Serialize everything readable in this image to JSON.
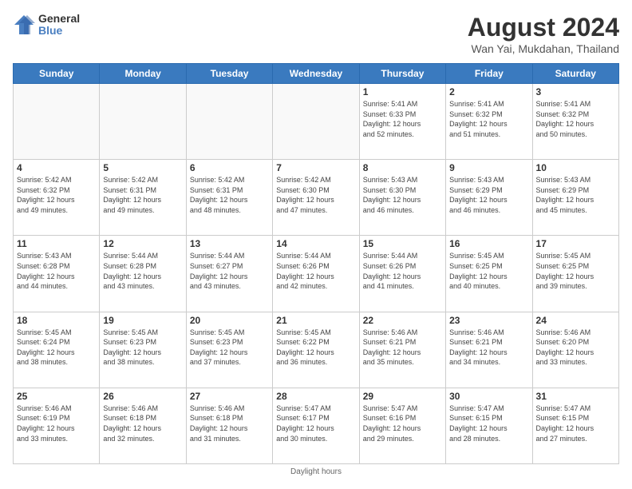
{
  "logo": {
    "general": "General",
    "blue": "Blue"
  },
  "title": "August 2024",
  "subtitle": "Wan Yai, Mukdahan, Thailand",
  "days_of_week": [
    "Sunday",
    "Monday",
    "Tuesday",
    "Wednesday",
    "Thursday",
    "Friday",
    "Saturday"
  ],
  "footer": "Daylight hours",
  "weeks": [
    [
      {
        "day": "",
        "info": ""
      },
      {
        "day": "",
        "info": ""
      },
      {
        "day": "",
        "info": ""
      },
      {
        "day": "",
        "info": ""
      },
      {
        "day": "1",
        "info": "Sunrise: 5:41 AM\nSunset: 6:33 PM\nDaylight: 12 hours\nand 52 minutes."
      },
      {
        "day": "2",
        "info": "Sunrise: 5:41 AM\nSunset: 6:32 PM\nDaylight: 12 hours\nand 51 minutes."
      },
      {
        "day": "3",
        "info": "Sunrise: 5:41 AM\nSunset: 6:32 PM\nDaylight: 12 hours\nand 50 minutes."
      }
    ],
    [
      {
        "day": "4",
        "info": "Sunrise: 5:42 AM\nSunset: 6:32 PM\nDaylight: 12 hours\nand 49 minutes."
      },
      {
        "day": "5",
        "info": "Sunrise: 5:42 AM\nSunset: 6:31 PM\nDaylight: 12 hours\nand 49 minutes."
      },
      {
        "day": "6",
        "info": "Sunrise: 5:42 AM\nSunset: 6:31 PM\nDaylight: 12 hours\nand 48 minutes."
      },
      {
        "day": "7",
        "info": "Sunrise: 5:42 AM\nSunset: 6:30 PM\nDaylight: 12 hours\nand 47 minutes."
      },
      {
        "day": "8",
        "info": "Sunrise: 5:43 AM\nSunset: 6:30 PM\nDaylight: 12 hours\nand 46 minutes."
      },
      {
        "day": "9",
        "info": "Sunrise: 5:43 AM\nSunset: 6:29 PM\nDaylight: 12 hours\nand 46 minutes."
      },
      {
        "day": "10",
        "info": "Sunrise: 5:43 AM\nSunset: 6:29 PM\nDaylight: 12 hours\nand 45 minutes."
      }
    ],
    [
      {
        "day": "11",
        "info": "Sunrise: 5:43 AM\nSunset: 6:28 PM\nDaylight: 12 hours\nand 44 minutes."
      },
      {
        "day": "12",
        "info": "Sunrise: 5:44 AM\nSunset: 6:28 PM\nDaylight: 12 hours\nand 43 minutes."
      },
      {
        "day": "13",
        "info": "Sunrise: 5:44 AM\nSunset: 6:27 PM\nDaylight: 12 hours\nand 43 minutes."
      },
      {
        "day": "14",
        "info": "Sunrise: 5:44 AM\nSunset: 6:26 PM\nDaylight: 12 hours\nand 42 minutes."
      },
      {
        "day": "15",
        "info": "Sunrise: 5:44 AM\nSunset: 6:26 PM\nDaylight: 12 hours\nand 41 minutes."
      },
      {
        "day": "16",
        "info": "Sunrise: 5:45 AM\nSunset: 6:25 PM\nDaylight: 12 hours\nand 40 minutes."
      },
      {
        "day": "17",
        "info": "Sunrise: 5:45 AM\nSunset: 6:25 PM\nDaylight: 12 hours\nand 39 minutes."
      }
    ],
    [
      {
        "day": "18",
        "info": "Sunrise: 5:45 AM\nSunset: 6:24 PM\nDaylight: 12 hours\nand 38 minutes."
      },
      {
        "day": "19",
        "info": "Sunrise: 5:45 AM\nSunset: 6:23 PM\nDaylight: 12 hours\nand 38 minutes."
      },
      {
        "day": "20",
        "info": "Sunrise: 5:45 AM\nSunset: 6:23 PM\nDaylight: 12 hours\nand 37 minutes."
      },
      {
        "day": "21",
        "info": "Sunrise: 5:45 AM\nSunset: 6:22 PM\nDaylight: 12 hours\nand 36 minutes."
      },
      {
        "day": "22",
        "info": "Sunrise: 5:46 AM\nSunset: 6:21 PM\nDaylight: 12 hours\nand 35 minutes."
      },
      {
        "day": "23",
        "info": "Sunrise: 5:46 AM\nSunset: 6:21 PM\nDaylight: 12 hours\nand 34 minutes."
      },
      {
        "day": "24",
        "info": "Sunrise: 5:46 AM\nSunset: 6:20 PM\nDaylight: 12 hours\nand 33 minutes."
      }
    ],
    [
      {
        "day": "25",
        "info": "Sunrise: 5:46 AM\nSunset: 6:19 PM\nDaylight: 12 hours\nand 33 minutes."
      },
      {
        "day": "26",
        "info": "Sunrise: 5:46 AM\nSunset: 6:18 PM\nDaylight: 12 hours\nand 32 minutes."
      },
      {
        "day": "27",
        "info": "Sunrise: 5:46 AM\nSunset: 6:18 PM\nDaylight: 12 hours\nand 31 minutes."
      },
      {
        "day": "28",
        "info": "Sunrise: 5:47 AM\nSunset: 6:17 PM\nDaylight: 12 hours\nand 30 minutes."
      },
      {
        "day": "29",
        "info": "Sunrise: 5:47 AM\nSunset: 6:16 PM\nDaylight: 12 hours\nand 29 minutes."
      },
      {
        "day": "30",
        "info": "Sunrise: 5:47 AM\nSunset: 6:15 PM\nDaylight: 12 hours\nand 28 minutes."
      },
      {
        "day": "31",
        "info": "Sunrise: 5:47 AM\nSunset: 6:15 PM\nDaylight: 12 hours\nand 27 minutes."
      }
    ]
  ]
}
